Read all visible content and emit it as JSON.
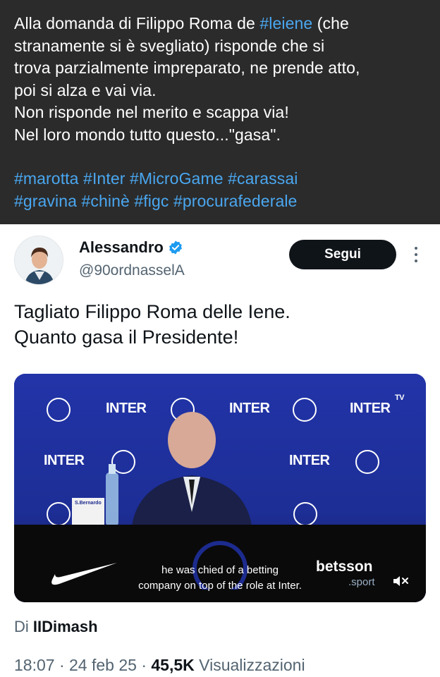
{
  "quoted_post": {
    "text_lines": [
      [
        {
          "t": "Alla domanda di Filippo Roma de ",
          "h": false
        },
        {
          "t": "#leiene",
          "h": true
        },
        {
          "t": " (che",
          "h": false
        }
      ],
      [
        {
          "t": "stranamente si è svegliato) risponde che si",
          "h": false
        }
      ],
      [
        {
          "t": "trova parzialmente impreparato, ne prende atto,",
          "h": false
        }
      ],
      [
        {
          "t": "poi si alza e vai via.",
          "h": false
        }
      ],
      [
        {
          "t": "Non risponde nel merito e scappa via!",
          "h": false
        }
      ],
      [
        {
          "t": "Nel loro mondo tutto questo...\"gasa\".",
          "h": false
        }
      ]
    ],
    "hashtag_lines": [
      "#marotta #Inter #MicroGame #carassai",
      "#gravina #chinè #figc #procurafederale"
    ],
    "colors": {
      "background": "#2b2b2b",
      "hashtag": "#4aa7f0"
    }
  },
  "tweet": {
    "author": {
      "name": "Alessandro",
      "username": "@90ordnasselA",
      "verified": true
    },
    "follow_label": "Segui",
    "text_line1": "Tagliato Filippo Roma delle Iene.",
    "text_line2": "Quanto gasa il Presidente!",
    "video": {
      "wall_text": "INTER",
      "caption_line1": "he was chied of a betting",
      "caption_line2": "company on top of the role at Inter.",
      "sponsor": "betsson",
      "sponsor_sub": ".sport",
      "bottle_label": "S.Bernardo",
      "tv_mark": "TV"
    },
    "via_prefix": "Di ",
    "via_name": "IIDimash",
    "time": "18:07",
    "date": "24 feb 25",
    "views_count": "45,5K",
    "views_label": "Visualizzazioni",
    "sep": "·"
  }
}
